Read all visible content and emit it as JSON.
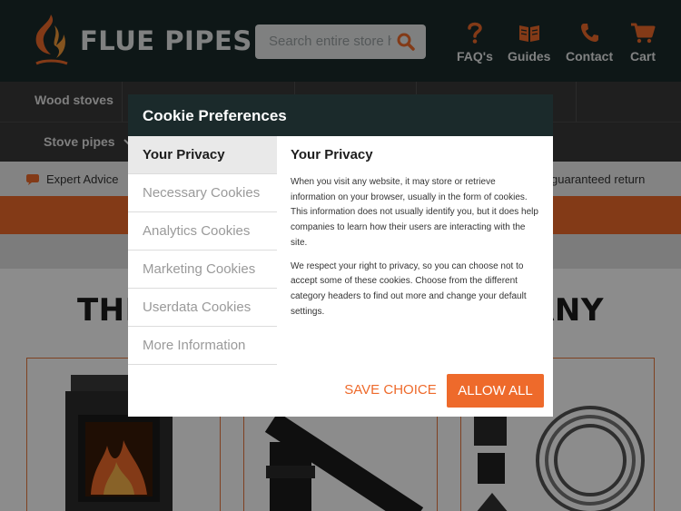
{
  "header": {
    "brand": "FLUE PIPES",
    "search": {
      "placeholder": "Search entire store here..."
    },
    "nav": [
      {
        "label": "FAQ's",
        "icon": "question-icon"
      },
      {
        "label": "Guides",
        "icon": "book-icon"
      },
      {
        "label": "Contact",
        "icon": "phone-icon"
      },
      {
        "label": "Cart",
        "icon": "cart-icon"
      }
    ]
  },
  "navbar": {
    "items": [
      {
        "label": "Wood stoves"
      },
      {
        "label": "Stove pipes"
      }
    ]
  },
  "strip": {
    "left": "Expert Advice",
    "right": "guaranteed return"
  },
  "page": {
    "headline_left": "THE U",
    "headline_right": "PANY"
  },
  "cookie_modal": {
    "title": "Cookie Preferences",
    "tabs": [
      {
        "label": "Your Privacy",
        "active": true
      },
      {
        "label": "Necessary Cookies",
        "active": false
      },
      {
        "label": "Analytics Cookies",
        "active": false
      },
      {
        "label": "Marketing Cookies",
        "active": false
      },
      {
        "label": "Userdata Cookies",
        "active": false
      },
      {
        "label": "More Information",
        "active": false
      }
    ],
    "content_title": "Your Privacy",
    "paragraphs": [
      "When you visit any website, it may store or retrieve information on your browser, usually in the form of cookies. This information does not usually identify you, but it does help companies to learn how their users are interacting with the site.",
      "We respect your right to privacy, so you can choose not to accept some of these cookies. Choose from the different category headers to find out more and change your default settings."
    ],
    "save_label": "SAVE CHOICE",
    "allow_label": "ALLOW ALL"
  },
  "colors": {
    "brand_orange": "#ee6a2b",
    "header_dark": "#1b2a2b",
    "nav_grey": "#3a3a3a"
  }
}
